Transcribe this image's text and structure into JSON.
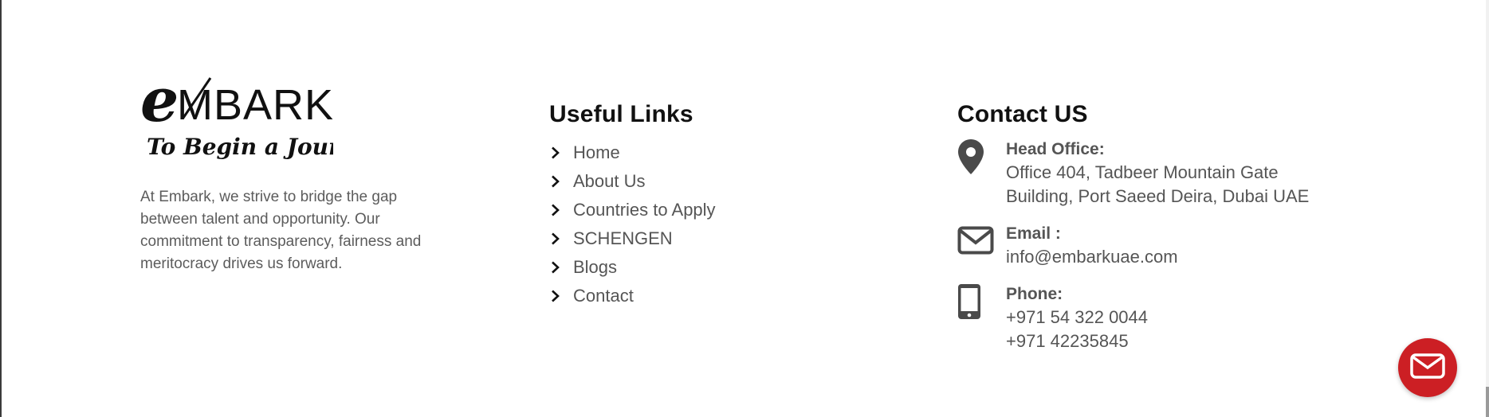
{
  "brand": {
    "logo_wordmark": "MBARK",
    "logo_e": "e",
    "logo_tagline": "To Begin a Journey",
    "about_text": "At Embark, we strive to bridge the gap between talent and opportunity. Our commitment to transparency, fairness and meritocracy drives us forward."
  },
  "links": {
    "heading": "Useful Links",
    "items": [
      {
        "label": "Home"
      },
      {
        "label": "About Us"
      },
      {
        "label": "Countries to Apply"
      },
      {
        "label": "SCHENGEN"
      },
      {
        "label": "Blogs"
      },
      {
        "label": "Contact"
      }
    ]
  },
  "contact": {
    "heading": "Contact US",
    "head_office": {
      "label": "Head Office:",
      "line1": "Office 404, Tadbeer Mountain Gate",
      "line2": "Building, Port Saeed Deira, Dubai UAE",
      "icon": "map-pin-icon"
    },
    "email": {
      "label": "Email :",
      "value": "info@embarkuae.com",
      "icon": "envelope-icon"
    },
    "phone": {
      "label": "Phone:",
      "value1": "+971 54 322 0044",
      "value2": "+971 42235845",
      "icon": "mobile-phone-icon"
    }
  },
  "fab": {
    "icon": "envelope-icon",
    "color": "#cc1f24"
  },
  "colors": {
    "text": "#555555",
    "heading": "#111111",
    "accent": "#cc1f24"
  }
}
